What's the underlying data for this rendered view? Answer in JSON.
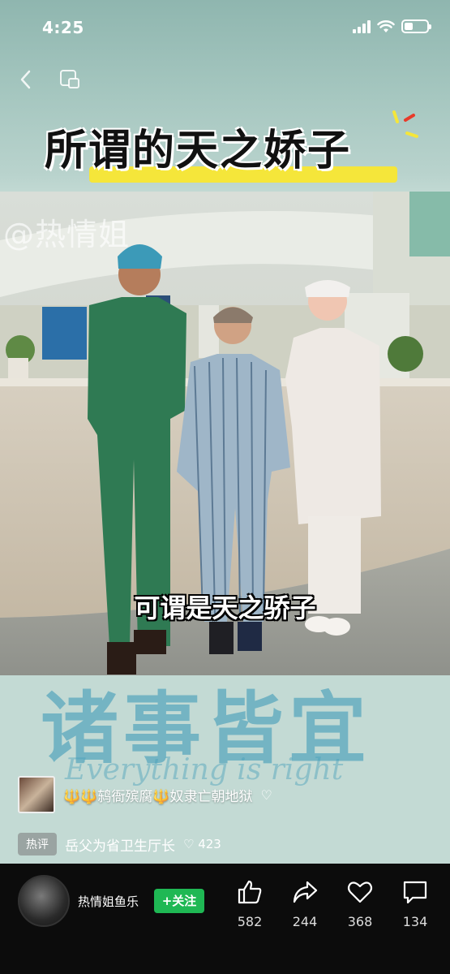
{
  "status_bar": {
    "time": "4:25"
  },
  "video": {
    "title": "所谓的天之娇子",
    "watermark": "@热情姐",
    "caption": "可谓是天之骄子",
    "slogan_cn": "诸事皆宜",
    "slogan_en": "Everything is right"
  },
  "danmu": {
    "text": "🔱🔱鸫衙殡腐🔱奴隶亡朝地狱"
  },
  "hot_comment": {
    "badge": "热评",
    "text": "岳父为省卫生厅长",
    "likes": "423"
  },
  "author": {
    "name": "热情姐鱼乐",
    "follow_label": "+关注"
  },
  "actions": [
    {
      "name": "like",
      "count": "582"
    },
    {
      "name": "share",
      "count": "244"
    },
    {
      "name": "favorite",
      "count": "368"
    },
    {
      "name": "comment",
      "count": "134"
    }
  ],
  "colors": {
    "follow": "#1fb854",
    "bar_bg": "#0c0c0c",
    "title_highlight": "#f5e63a"
  }
}
